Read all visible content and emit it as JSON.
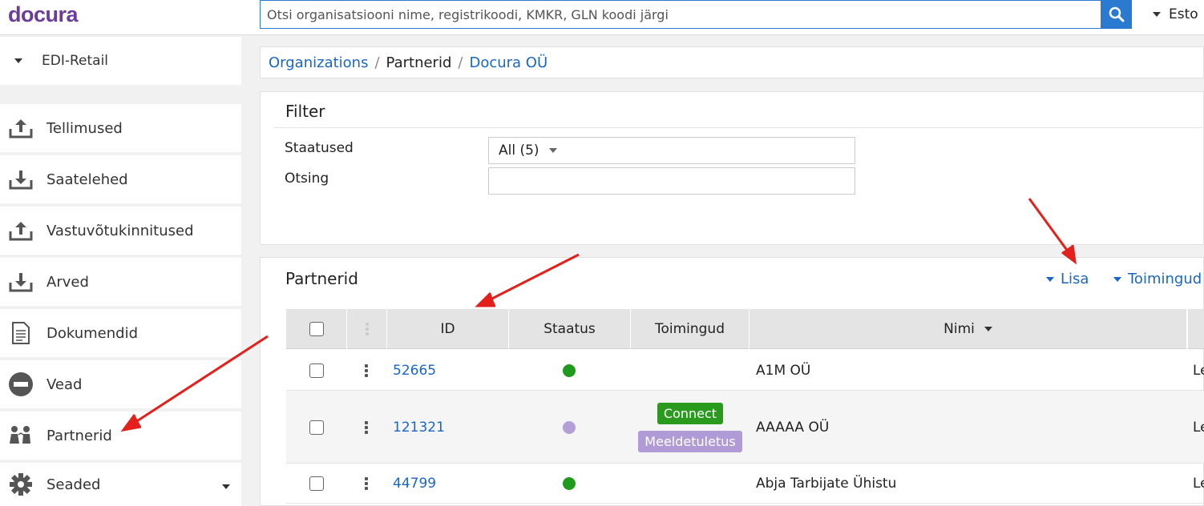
{
  "app": {
    "logo_text": "docura",
    "search_placeholder": "Otsi organisatsiooni nime, registrikoodi, KMKR, GLN koodi järgi",
    "language": "Esto"
  },
  "sidebar": {
    "section": "EDI-Retail",
    "items": [
      {
        "label": "Tellimused",
        "icon": "upload-tray-icon"
      },
      {
        "label": "Saatelehed",
        "icon": "download-tray-icon"
      },
      {
        "label": "Vastuvõtukinnitused",
        "icon": "upload-tray-icon"
      },
      {
        "label": "Arved",
        "icon": "download-tray-icon"
      },
      {
        "label": "Dokumendid",
        "icon": "document-icon"
      },
      {
        "label": "Vead",
        "icon": "no-entry-icon"
      },
      {
        "label": "Partnerid",
        "icon": "people-icon"
      },
      {
        "label": "Seaded",
        "icon": "gear-icon"
      }
    ]
  },
  "breadcrumb": {
    "organizations": "Organizations",
    "sep": "/",
    "partners": "Partnerid",
    "company": "Docura OÜ"
  },
  "filter": {
    "title": "Filter",
    "status_label": "Staatused",
    "status_value": "All (5)",
    "search_label": "Otsing",
    "search_value": ""
  },
  "partners": {
    "title": "Partnerid",
    "add_label": "Lisa",
    "actions_label": "Toimingud",
    "columns": {
      "id": "ID",
      "status": "Staatus",
      "actions": "Toimingud",
      "name": "Nimi"
    },
    "rows": [
      {
        "id": "52665",
        "status_color": "#1f9a1f",
        "name": "A1M OÜ",
        "extra": "Le",
        "buttons": []
      },
      {
        "id": "121321",
        "status_color": "#b3a0d8",
        "name": "AAAAA OÜ",
        "extra": "Le",
        "buttons": [
          "Connect",
          "Meeldetuletus"
        ]
      },
      {
        "id": "44799",
        "status_color": "#1f9a1f",
        "name": "Abja Tarbijate Ühistu",
        "extra": "Le",
        "buttons": []
      }
    ]
  },
  "colors": {
    "accent": "#1a66c7",
    "brand": "#6a3d9a",
    "annotation_arrow": "#e3201b"
  }
}
